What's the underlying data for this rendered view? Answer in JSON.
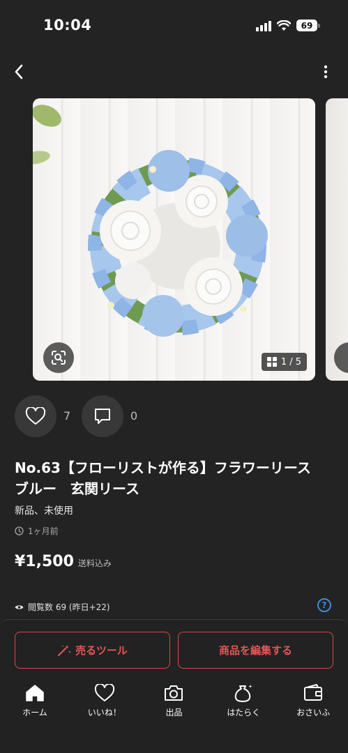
{
  "status_bar": {
    "time": "10:04",
    "battery": "69"
  },
  "carousel": {
    "counter": "1 / 5"
  },
  "reactions": {
    "likes": "7",
    "comments": "0"
  },
  "item": {
    "title": "No.63【フローリストが作る】フラワーリース　ブルー　玄関リース",
    "condition": "新品、未使用",
    "posted": "1ヶ月前",
    "price": "¥1,500",
    "shipping_note": "送料込み",
    "views": "閲覧数  69 (昨日+22)"
  },
  "actions": {
    "sell_tool": "売るツール",
    "edit_item": "商品を編集する"
  },
  "bottom_nav": [
    {
      "label": "ホーム",
      "icon": "home-icon"
    },
    {
      "label": "いいね！",
      "icon": "heart-icon"
    },
    {
      "label": "出品",
      "icon": "camera-icon"
    },
    {
      "label": "はたらく",
      "icon": "money-bag-icon"
    },
    {
      "label": "おさいふ",
      "icon": "wallet-icon"
    }
  ],
  "colors": {
    "background": "#232323",
    "accent_red": "#e35656",
    "help_blue": "#3d8bdc"
  }
}
